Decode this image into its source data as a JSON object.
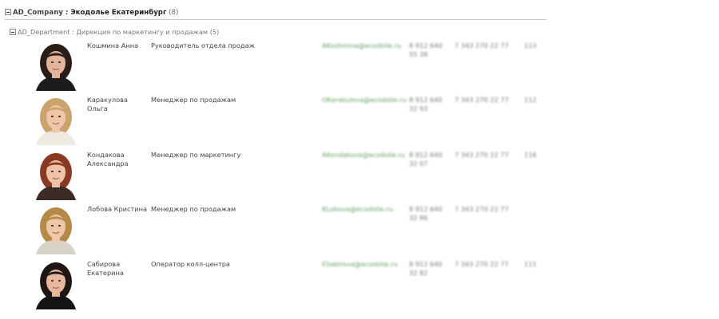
{
  "group": {
    "label": "AD_Company",
    "separator": " : ",
    "value": "Экодолье Екатеринбург",
    "count": "(8)"
  },
  "subgroup": {
    "text": "AD_Department : Дирекция по маркетингу и продажам (5)"
  },
  "employees": [
    {
      "name": "Кошмина Анна",
      "title": "Руководитель отдела продаж",
      "email": "AKoshmina@ecodolie.ru",
      "mobile": "8 912 640 55 38",
      "work_phone": "7 343 270 22 77",
      "ext": "113",
      "photo": {
        "bg": "#ffffff",
        "hair": "#2a1d17",
        "skin": "#e2b49c",
        "top": "#1c1c1c"
      }
    },
    {
      "name": "Каракулова  Ольга",
      "title": "Менеджер по продажам",
      "email": "OKarakulova@ecodolie.ru",
      "mobile": "8 912 640 32 93",
      "work_phone": "7 343 270 22 77",
      "ext": "112",
      "photo": {
        "bg": "#ffffff",
        "hair": "#c9a26c",
        "skin": "#f0c6a8",
        "top": "#efe9e2"
      }
    },
    {
      "name": "Кондакова  Александра",
      "title": "Менеджер по маркетингу",
      "email": "AKondakova@ecodolie.ru",
      "mobile": "8 912 640 32 07",
      "work_phone": "7 343 270 22 77",
      "ext": "116",
      "photo": {
        "bg": "#ffffff",
        "hair": "#8a3a22",
        "skin": "#efc3a8",
        "top": "#3b2a25"
      }
    },
    {
      "name": "Лобова  Кристина",
      "title": "Менеджер по продажам",
      "email": "KLobova@ecodolie.ru",
      "mobile": "8 912 640 32 86",
      "work_phone": "7 343 270 22 77",
      "ext": "",
      "photo": {
        "bg": "#ffffff",
        "hair": "#b58a48",
        "skin": "#efc6a6",
        "top": "#d9d2c8"
      }
    },
    {
      "name": "Сабирова  Екатерина",
      "title": "Оператор колл-центра",
      "email": "ESabirova@ecodolie.ru",
      "mobile": "8 912 640 32 82",
      "work_phone": "7 343 270 22 77",
      "ext": "111",
      "photo": {
        "bg": "#ffffff",
        "hair": "#1f1613",
        "skin": "#e7b89e",
        "top": "#141414"
      }
    }
  ]
}
